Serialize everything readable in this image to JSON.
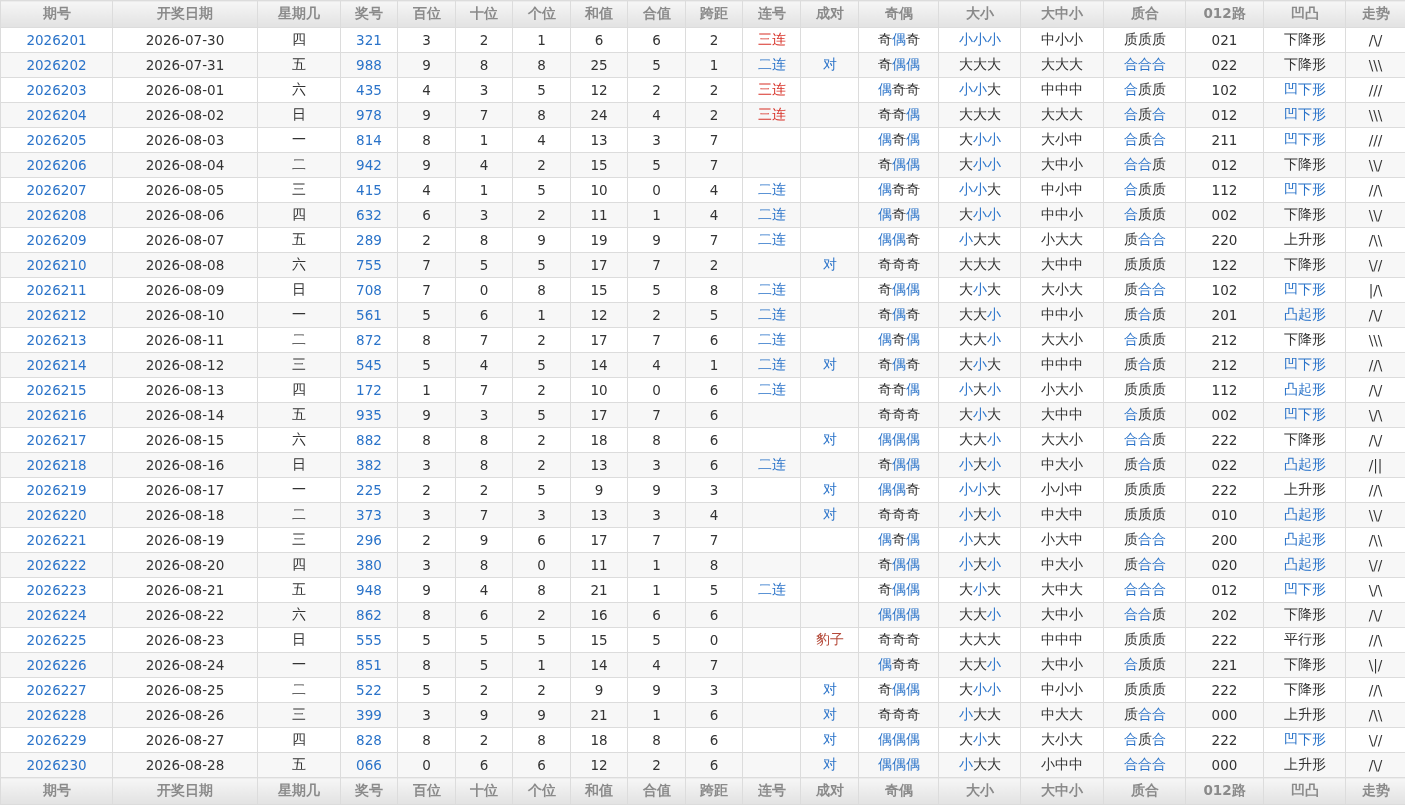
{
  "columns": [
    "期号",
    "开奖日期",
    "星期几",
    "奖号",
    "百位",
    "十位",
    "个位",
    "和值",
    "合值",
    "跨距",
    "连号",
    "成对",
    "奇偶",
    "大小",
    "大中小",
    "质合",
    "012路",
    "凹凸",
    "走势"
  ],
  "rows": [
    {
      "issue": "2026201",
      "date": "2026-07-30",
      "weekday": "四",
      "number": "321",
      "hundreds": "3",
      "tens": "2",
      "units": "1",
      "sum": "6",
      "sum_tail": "6",
      "span": "2",
      "consec": {
        "text": "三连",
        "kind": "triple"
      },
      "odd_even": [
        [
          "奇",
          false
        ],
        [
          "偶",
          true
        ],
        [
          "奇",
          false
        ]
      ],
      "big_small": [
        [
          "小",
          true
        ],
        [
          "小",
          true
        ],
        [
          "小",
          true
        ]
      ],
      "big_mid_small": "中小小",
      "prime_composite": [
        [
          "质",
          false
        ],
        [
          "质",
          false
        ],
        [
          "质",
          false
        ]
      ],
      "route_012": "021",
      "shape": {
        "text": "下降形",
        "highlight": false
      },
      "trend": "/\\/"
    },
    {
      "issue": "2026202",
      "date": "2026-07-31",
      "weekday": "五",
      "number": "988",
      "hundreds": "9",
      "tens": "8",
      "units": "8",
      "sum": "25",
      "sum_tail": "5",
      "span": "1",
      "consec": {
        "text": "二连",
        "kind": "double"
      },
      "pair": {
        "text": "对",
        "kind": "pair"
      },
      "odd_even": [
        [
          "奇",
          false
        ],
        [
          "偶",
          true
        ],
        [
          "偶",
          true
        ]
      ],
      "big_small": [
        [
          "大",
          false
        ],
        [
          "大",
          false
        ],
        [
          "大",
          false
        ]
      ],
      "big_mid_small": "大大大",
      "prime_composite": [
        [
          "合",
          true
        ],
        [
          "合",
          true
        ],
        [
          "合",
          true
        ]
      ],
      "route_012": "022",
      "shape": {
        "text": "下降形",
        "highlight": false
      },
      "trend": "\\\\\\"
    },
    {
      "issue": "2026203",
      "date": "2026-08-01",
      "weekday": "六",
      "number": "435",
      "hundreds": "4",
      "tens": "3",
      "units": "5",
      "sum": "12",
      "sum_tail": "2",
      "span": "2",
      "consec": {
        "text": "三连",
        "kind": "triple"
      },
      "odd_even": [
        [
          "偶",
          true
        ],
        [
          "奇",
          false
        ],
        [
          "奇",
          false
        ]
      ],
      "big_small": [
        [
          "小",
          true
        ],
        [
          "小",
          true
        ],
        [
          "大",
          false
        ]
      ],
      "big_mid_small": "中中中",
      "prime_composite": [
        [
          "合",
          true
        ],
        [
          "质",
          false
        ],
        [
          "质",
          false
        ]
      ],
      "route_012": "102",
      "shape": {
        "text": "凹下形",
        "highlight": true
      },
      "trend": "///"
    },
    {
      "issue": "2026204",
      "date": "2026-08-02",
      "weekday": "日",
      "number": "978",
      "hundreds": "9",
      "tens": "7",
      "units": "8",
      "sum": "24",
      "sum_tail": "4",
      "span": "2",
      "consec": {
        "text": "三连",
        "kind": "triple"
      },
      "odd_even": [
        [
          "奇",
          false
        ],
        [
          "奇",
          false
        ],
        [
          "偶",
          true
        ]
      ],
      "big_small": [
        [
          "大",
          false
        ],
        [
          "大",
          false
        ],
        [
          "大",
          false
        ]
      ],
      "big_mid_small": "大大大",
      "prime_composite": [
        [
          "合",
          true
        ],
        [
          "质",
          false
        ],
        [
          "合",
          true
        ]
      ],
      "route_012": "012",
      "shape": {
        "text": "凹下形",
        "highlight": true
      },
      "trend": "\\\\\\"
    },
    {
      "issue": "2026205",
      "date": "2026-08-03",
      "weekday": "一",
      "number": "814",
      "hundreds": "8",
      "tens": "1",
      "units": "4",
      "sum": "13",
      "sum_tail": "3",
      "span": "7",
      "odd_even": [
        [
          "偶",
          true
        ],
        [
          "奇",
          false
        ],
        [
          "偶",
          true
        ]
      ],
      "big_small": [
        [
          "大",
          false
        ],
        [
          "小",
          true
        ],
        [
          "小",
          true
        ]
      ],
      "big_mid_small": "大小中",
      "prime_composite": [
        [
          "合",
          true
        ],
        [
          "质",
          false
        ],
        [
          "合",
          true
        ]
      ],
      "route_012": "211",
      "shape": {
        "text": "凹下形",
        "highlight": true
      },
      "trend": "///"
    },
    {
      "issue": "2026206",
      "date": "2026-08-04",
      "weekday": "二",
      "number": "942",
      "hundreds": "9",
      "tens": "4",
      "units": "2",
      "sum": "15",
      "sum_tail": "5",
      "span": "7",
      "odd_even": [
        [
          "奇",
          false
        ],
        [
          "偶",
          true
        ],
        [
          "偶",
          true
        ]
      ],
      "big_small": [
        [
          "大",
          false
        ],
        [
          "小",
          true
        ],
        [
          "小",
          true
        ]
      ],
      "big_mid_small": "大中小",
      "prime_composite": [
        [
          "合",
          true
        ],
        [
          "合",
          true
        ],
        [
          "质",
          false
        ]
      ],
      "route_012": "012",
      "shape": {
        "text": "下降形",
        "highlight": false
      },
      "trend": "\\\\/"
    },
    {
      "issue": "2026207",
      "date": "2026-08-05",
      "weekday": "三",
      "number": "415",
      "hundreds": "4",
      "tens": "1",
      "units": "5",
      "sum": "10",
      "sum_tail": "0",
      "span": "4",
      "consec": {
        "text": "二连",
        "kind": "double"
      },
      "odd_even": [
        [
          "偶",
          true
        ],
        [
          "奇",
          false
        ],
        [
          "奇",
          false
        ]
      ],
      "big_small": [
        [
          "小",
          true
        ],
        [
          "小",
          true
        ],
        [
          "大",
          false
        ]
      ],
      "big_mid_small": "中小中",
      "prime_composite": [
        [
          "合",
          true
        ],
        [
          "质",
          false
        ],
        [
          "质",
          false
        ]
      ],
      "route_012": "112",
      "shape": {
        "text": "凹下形",
        "highlight": true
      },
      "trend": "//\\"
    },
    {
      "issue": "2026208",
      "date": "2026-08-06",
      "weekday": "四",
      "number": "632",
      "hundreds": "6",
      "tens": "3",
      "units": "2",
      "sum": "11",
      "sum_tail": "1",
      "span": "4",
      "consec": {
        "text": "二连",
        "kind": "double"
      },
      "odd_even": [
        [
          "偶",
          true
        ],
        [
          "奇",
          false
        ],
        [
          "偶",
          true
        ]
      ],
      "big_small": [
        [
          "大",
          false
        ],
        [
          "小",
          true
        ],
        [
          "小",
          true
        ]
      ],
      "big_mid_small": "中中小",
      "prime_composite": [
        [
          "合",
          true
        ],
        [
          "质",
          false
        ],
        [
          "质",
          false
        ]
      ],
      "route_012": "002",
      "shape": {
        "text": "下降形",
        "highlight": false
      },
      "trend": "\\\\/"
    },
    {
      "issue": "2026209",
      "date": "2026-08-07",
      "weekday": "五",
      "number": "289",
      "hundreds": "2",
      "tens": "8",
      "units": "9",
      "sum": "19",
      "sum_tail": "9",
      "span": "7",
      "consec": {
        "text": "二连",
        "kind": "double"
      },
      "odd_even": [
        [
          "偶",
          true
        ],
        [
          "偶",
          true
        ],
        [
          "奇",
          false
        ]
      ],
      "big_small": [
        [
          "小",
          true
        ],
        [
          "大",
          false
        ],
        [
          "大",
          false
        ]
      ],
      "big_mid_small": "小大大",
      "prime_composite": [
        [
          "质",
          false
        ],
        [
          "合",
          true
        ],
        [
          "合",
          true
        ]
      ],
      "route_012": "220",
      "shape": {
        "text": "上升形",
        "highlight": false
      },
      "trend": "/\\\\"
    },
    {
      "issue": "2026210",
      "date": "2026-08-08",
      "weekday": "六",
      "number": "755",
      "hundreds": "7",
      "tens": "5",
      "units": "5",
      "sum": "17",
      "sum_tail": "7",
      "span": "2",
      "pair": {
        "text": "对",
        "kind": "pair"
      },
      "odd_even": [
        [
          "奇",
          false
        ],
        [
          "奇",
          false
        ],
        [
          "奇",
          false
        ]
      ],
      "big_small": [
        [
          "大",
          false
        ],
        [
          "大",
          false
        ],
        [
          "大",
          false
        ]
      ],
      "big_mid_small": "大中中",
      "prime_composite": [
        [
          "质",
          false
        ],
        [
          "质",
          false
        ],
        [
          "质",
          false
        ]
      ],
      "route_012": "122",
      "shape": {
        "text": "下降形",
        "highlight": false
      },
      "trend": "\\//"
    },
    {
      "issue": "2026211",
      "date": "2026-08-09",
      "weekday": "日",
      "number": "708",
      "hundreds": "7",
      "tens": "0",
      "units": "8",
      "sum": "15",
      "sum_tail": "5",
      "span": "8",
      "consec": {
        "text": "二连",
        "kind": "double"
      },
      "odd_even": [
        [
          "奇",
          false
        ],
        [
          "偶",
          true
        ],
        [
          "偶",
          true
        ]
      ],
      "big_small": [
        [
          "大",
          false
        ],
        [
          "小",
          true
        ],
        [
          "大",
          false
        ]
      ],
      "big_mid_small": "大小大",
      "prime_composite": [
        [
          "质",
          false
        ],
        [
          "合",
          true
        ],
        [
          "合",
          true
        ]
      ],
      "route_012": "102",
      "shape": {
        "text": "凹下形",
        "highlight": true
      },
      "trend": "|/\\"
    },
    {
      "issue": "2026212",
      "date": "2026-08-10",
      "weekday": "一",
      "number": "561",
      "hundreds": "5",
      "tens": "6",
      "units": "1",
      "sum": "12",
      "sum_tail": "2",
      "span": "5",
      "consec": {
        "text": "二连",
        "kind": "double"
      },
      "odd_even": [
        [
          "奇",
          false
        ],
        [
          "偶",
          true
        ],
        [
          "奇",
          false
        ]
      ],
      "big_small": [
        [
          "大",
          false
        ],
        [
          "大",
          false
        ],
        [
          "小",
          true
        ]
      ],
      "big_mid_small": "中中小",
      "prime_composite": [
        [
          "质",
          false
        ],
        [
          "合",
          true
        ],
        [
          "质",
          false
        ]
      ],
      "route_012": "201",
      "shape": {
        "text": "凸起形",
        "highlight": true
      },
      "trend": "/\\/"
    },
    {
      "issue": "2026213",
      "date": "2026-08-11",
      "weekday": "二",
      "number": "872",
      "hundreds": "8",
      "tens": "7",
      "units": "2",
      "sum": "17",
      "sum_tail": "7",
      "span": "6",
      "consec": {
        "text": "二连",
        "kind": "double"
      },
      "odd_even": [
        [
          "偶",
          true
        ],
        [
          "奇",
          false
        ],
        [
          "偶",
          true
        ]
      ],
      "big_small": [
        [
          "大",
          false
        ],
        [
          "大",
          false
        ],
        [
          "小",
          true
        ]
      ],
      "big_mid_small": "大大小",
      "prime_composite": [
        [
          "合",
          true
        ],
        [
          "质",
          false
        ],
        [
          "质",
          false
        ]
      ],
      "route_012": "212",
      "shape": {
        "text": "下降形",
        "highlight": false
      },
      "trend": "\\\\\\"
    },
    {
      "issue": "2026214",
      "date": "2026-08-12",
      "weekday": "三",
      "number": "545",
      "hundreds": "5",
      "tens": "4",
      "units": "5",
      "sum": "14",
      "sum_tail": "4",
      "span": "1",
      "consec": {
        "text": "二连",
        "kind": "double"
      },
      "pair": {
        "text": "对",
        "kind": "pair"
      },
      "odd_even": [
        [
          "奇",
          false
        ],
        [
          "偶",
          true
        ],
        [
          "奇",
          false
        ]
      ],
      "big_small": [
        [
          "大",
          false
        ],
        [
          "小",
          true
        ],
        [
          "大",
          false
        ]
      ],
      "big_mid_small": "中中中",
      "prime_composite": [
        [
          "质",
          false
        ],
        [
          "合",
          true
        ],
        [
          "质",
          false
        ]
      ],
      "route_012": "212",
      "shape": {
        "text": "凹下形",
        "highlight": true
      },
      "trend": "//\\"
    },
    {
      "issue": "2026215",
      "date": "2026-08-13",
      "weekday": "四",
      "number": "172",
      "hundreds": "1",
      "tens": "7",
      "units": "2",
      "sum": "10",
      "sum_tail": "0",
      "span": "6",
      "consec": {
        "text": "二连",
        "kind": "double"
      },
      "odd_even": [
        [
          "奇",
          false
        ],
        [
          "奇",
          false
        ],
        [
          "偶",
          true
        ]
      ],
      "big_small": [
        [
          "小",
          true
        ],
        [
          "大",
          false
        ],
        [
          "小",
          true
        ]
      ],
      "big_mid_small": "小大小",
      "prime_composite": [
        [
          "质",
          false
        ],
        [
          "质",
          false
        ],
        [
          "质",
          false
        ]
      ],
      "route_012": "112",
      "shape": {
        "text": "凸起形",
        "highlight": true
      },
      "trend": "/\\/"
    },
    {
      "issue": "2026216",
      "date": "2026-08-14",
      "weekday": "五",
      "number": "935",
      "hundreds": "9",
      "tens": "3",
      "units": "5",
      "sum": "17",
      "sum_tail": "7",
      "span": "6",
      "odd_even": [
        [
          "奇",
          false
        ],
        [
          "奇",
          false
        ],
        [
          "奇",
          false
        ]
      ],
      "big_small": [
        [
          "大",
          false
        ],
        [
          "小",
          true
        ],
        [
          "大",
          false
        ]
      ],
      "big_mid_small": "大中中",
      "prime_composite": [
        [
          "合",
          true
        ],
        [
          "质",
          false
        ],
        [
          "质",
          false
        ]
      ],
      "route_012": "002",
      "shape": {
        "text": "凹下形",
        "highlight": true
      },
      "trend": "\\/\\"
    },
    {
      "issue": "2026217",
      "date": "2026-08-15",
      "weekday": "六",
      "number": "882",
      "hundreds": "8",
      "tens": "8",
      "units": "2",
      "sum": "18",
      "sum_tail": "8",
      "span": "6",
      "pair": {
        "text": "对",
        "kind": "pair"
      },
      "odd_even": [
        [
          "偶",
          true
        ],
        [
          "偶",
          true
        ],
        [
          "偶",
          true
        ]
      ],
      "big_small": [
        [
          "大",
          false
        ],
        [
          "大",
          false
        ],
        [
          "小",
          true
        ]
      ],
      "big_mid_small": "大大小",
      "prime_composite": [
        [
          "合",
          true
        ],
        [
          "合",
          true
        ],
        [
          "质",
          false
        ]
      ],
      "route_012": "222",
      "shape": {
        "text": "下降形",
        "highlight": false
      },
      "trend": "/\\/"
    },
    {
      "issue": "2026218",
      "date": "2026-08-16",
      "weekday": "日",
      "number": "382",
      "hundreds": "3",
      "tens": "8",
      "units": "2",
      "sum": "13",
      "sum_tail": "3",
      "span": "6",
      "consec": {
        "text": "二连",
        "kind": "double"
      },
      "odd_even": [
        [
          "奇",
          false
        ],
        [
          "偶",
          true
        ],
        [
          "偶",
          true
        ]
      ],
      "big_small": [
        [
          "小",
          true
        ],
        [
          "大",
          false
        ],
        [
          "小",
          true
        ]
      ],
      "big_mid_small": "中大小",
      "prime_composite": [
        [
          "质",
          false
        ],
        [
          "合",
          true
        ],
        [
          "质",
          false
        ]
      ],
      "route_012": "022",
      "shape": {
        "text": "凸起形",
        "highlight": true
      },
      "trend": "/||"
    },
    {
      "issue": "2026219",
      "date": "2026-08-17",
      "weekday": "一",
      "number": "225",
      "hundreds": "2",
      "tens": "2",
      "units": "5",
      "sum": "9",
      "sum_tail": "9",
      "span": "3",
      "pair": {
        "text": "对",
        "kind": "pair"
      },
      "odd_even": [
        [
          "偶",
          true
        ],
        [
          "偶",
          true
        ],
        [
          "奇",
          false
        ]
      ],
      "big_small": [
        [
          "小",
          true
        ],
        [
          "小",
          true
        ],
        [
          "大",
          false
        ]
      ],
      "big_mid_small": "小小中",
      "prime_composite": [
        [
          "质",
          false
        ],
        [
          "质",
          false
        ],
        [
          "质",
          false
        ]
      ],
      "route_012": "222",
      "shape": {
        "text": "上升形",
        "highlight": false
      },
      "trend": "//\\"
    },
    {
      "issue": "2026220",
      "date": "2026-08-18",
      "weekday": "二",
      "number": "373",
      "hundreds": "3",
      "tens": "7",
      "units": "3",
      "sum": "13",
      "sum_tail": "3",
      "span": "4",
      "pair": {
        "text": "对",
        "kind": "pair"
      },
      "odd_even": [
        [
          "奇",
          false
        ],
        [
          "奇",
          false
        ],
        [
          "奇",
          false
        ]
      ],
      "big_small": [
        [
          "小",
          true
        ],
        [
          "大",
          false
        ],
        [
          "小",
          true
        ]
      ],
      "big_mid_small": "中大中",
      "prime_composite": [
        [
          "质",
          false
        ],
        [
          "质",
          false
        ],
        [
          "质",
          false
        ]
      ],
      "route_012": "010",
      "shape": {
        "text": "凸起形",
        "highlight": true
      },
      "trend": "\\\\/"
    },
    {
      "issue": "2026221",
      "date": "2026-08-19",
      "weekday": "三",
      "number": "296",
      "hundreds": "2",
      "tens": "9",
      "units": "6",
      "sum": "17",
      "sum_tail": "7",
      "span": "7",
      "odd_even": [
        [
          "偶",
          true
        ],
        [
          "奇",
          false
        ],
        [
          "偶",
          true
        ]
      ],
      "big_small": [
        [
          "小",
          true
        ],
        [
          "大",
          false
        ],
        [
          "大",
          false
        ]
      ],
      "big_mid_small": "小大中",
      "prime_composite": [
        [
          "质",
          false
        ],
        [
          "合",
          true
        ],
        [
          "合",
          true
        ]
      ],
      "route_012": "200",
      "shape": {
        "text": "凸起形",
        "highlight": true
      },
      "trend": "/\\\\"
    },
    {
      "issue": "2026222",
      "date": "2026-08-20",
      "weekday": "四",
      "number": "380",
      "hundreds": "3",
      "tens": "8",
      "units": "0",
      "sum": "11",
      "sum_tail": "1",
      "span": "8",
      "odd_even": [
        [
          "奇",
          false
        ],
        [
          "偶",
          true
        ],
        [
          "偶",
          true
        ]
      ],
      "big_small": [
        [
          "小",
          true
        ],
        [
          "大",
          false
        ],
        [
          "小",
          true
        ]
      ],
      "big_mid_small": "中大小",
      "prime_composite": [
        [
          "质",
          false
        ],
        [
          "合",
          true
        ],
        [
          "合",
          true
        ]
      ],
      "route_012": "020",
      "shape": {
        "text": "凸起形",
        "highlight": true
      },
      "trend": "\\//"
    },
    {
      "issue": "2026223",
      "date": "2026-08-21",
      "weekday": "五",
      "number": "948",
      "hundreds": "9",
      "tens": "4",
      "units": "8",
      "sum": "21",
      "sum_tail": "1",
      "span": "5",
      "consec": {
        "text": "二连",
        "kind": "double"
      },
      "odd_even": [
        [
          "奇",
          false
        ],
        [
          "偶",
          true
        ],
        [
          "偶",
          true
        ]
      ],
      "big_small": [
        [
          "大",
          false
        ],
        [
          "小",
          true
        ],
        [
          "大",
          false
        ]
      ],
      "big_mid_small": "大中大",
      "prime_composite": [
        [
          "合",
          true
        ],
        [
          "合",
          true
        ],
        [
          "合",
          true
        ]
      ],
      "route_012": "012",
      "shape": {
        "text": "凹下形",
        "highlight": true
      },
      "trend": "\\/\\"
    },
    {
      "issue": "2026224",
      "date": "2026-08-22",
      "weekday": "六",
      "number": "862",
      "hundreds": "8",
      "tens": "6",
      "units": "2",
      "sum": "16",
      "sum_tail": "6",
      "span": "6",
      "odd_even": [
        [
          "偶",
          true
        ],
        [
          "偶",
          true
        ],
        [
          "偶",
          true
        ]
      ],
      "big_small": [
        [
          "大",
          false
        ],
        [
          "大",
          false
        ],
        [
          "小",
          true
        ]
      ],
      "big_mid_small": "大中小",
      "prime_composite": [
        [
          "合",
          true
        ],
        [
          "合",
          true
        ],
        [
          "质",
          false
        ]
      ],
      "route_012": "202",
      "shape": {
        "text": "下降形",
        "highlight": false
      },
      "trend": "/\\/"
    },
    {
      "issue": "2026225",
      "date": "2026-08-23",
      "weekday": "日",
      "number": "555",
      "hundreds": "5",
      "tens": "5",
      "units": "5",
      "sum": "15",
      "sum_tail": "5",
      "span": "0",
      "pair": {
        "text": "豹子",
        "kind": "leopard"
      },
      "odd_even": [
        [
          "奇",
          false
        ],
        [
          "奇",
          false
        ],
        [
          "奇",
          false
        ]
      ],
      "big_small": [
        [
          "大",
          false
        ],
        [
          "大",
          false
        ],
        [
          "大",
          false
        ]
      ],
      "big_mid_small": "中中中",
      "prime_composite": [
        [
          "质",
          false
        ],
        [
          "质",
          false
        ],
        [
          "质",
          false
        ]
      ],
      "route_012": "222",
      "shape": {
        "text": "平行形",
        "highlight": false
      },
      "trend": "//\\"
    },
    {
      "issue": "2026226",
      "date": "2026-08-24",
      "weekday": "一",
      "number": "851",
      "hundreds": "8",
      "tens": "5",
      "units": "1",
      "sum": "14",
      "sum_tail": "4",
      "span": "7",
      "odd_even": [
        [
          "偶",
          true
        ],
        [
          "奇",
          false
        ],
        [
          "奇",
          false
        ]
      ],
      "big_small": [
        [
          "大",
          false
        ],
        [
          "大",
          false
        ],
        [
          "小",
          true
        ]
      ],
      "big_mid_small": "大中小",
      "prime_composite": [
        [
          "合",
          true
        ],
        [
          "质",
          false
        ],
        [
          "质",
          false
        ]
      ],
      "route_012": "221",
      "shape": {
        "text": "下降形",
        "highlight": false
      },
      "trend": "\\|/"
    },
    {
      "issue": "2026227",
      "date": "2026-08-25",
      "weekday": "二",
      "number": "522",
      "hundreds": "5",
      "tens": "2",
      "units": "2",
      "sum": "9",
      "sum_tail": "9",
      "span": "3",
      "pair": {
        "text": "对",
        "kind": "pair"
      },
      "odd_even": [
        [
          "奇",
          false
        ],
        [
          "偶",
          true
        ],
        [
          "偶",
          true
        ]
      ],
      "big_small": [
        [
          "大",
          false
        ],
        [
          "小",
          true
        ],
        [
          "小",
          true
        ]
      ],
      "big_mid_small": "中小小",
      "prime_composite": [
        [
          "质",
          false
        ],
        [
          "质",
          false
        ],
        [
          "质",
          false
        ]
      ],
      "route_012": "222",
      "shape": {
        "text": "下降形",
        "highlight": false
      },
      "trend": "//\\"
    },
    {
      "issue": "2026228",
      "date": "2026-08-26",
      "weekday": "三",
      "number": "399",
      "hundreds": "3",
      "tens": "9",
      "units": "9",
      "sum": "21",
      "sum_tail": "1",
      "span": "6",
      "pair": {
        "text": "对",
        "kind": "pair"
      },
      "odd_even": [
        [
          "奇",
          false
        ],
        [
          "奇",
          false
        ],
        [
          "奇",
          false
        ]
      ],
      "big_small": [
        [
          "小",
          true
        ],
        [
          "大",
          false
        ],
        [
          "大",
          false
        ]
      ],
      "big_mid_small": "中大大",
      "prime_composite": [
        [
          "质",
          false
        ],
        [
          "合",
          true
        ],
        [
          "合",
          true
        ]
      ],
      "route_012": "000",
      "shape": {
        "text": "上升形",
        "highlight": false
      },
      "trend": "/\\\\"
    },
    {
      "issue": "2026229",
      "date": "2026-08-27",
      "weekday": "四",
      "number": "828",
      "hundreds": "8",
      "tens": "2",
      "units": "8",
      "sum": "18",
      "sum_tail": "8",
      "span": "6",
      "pair": {
        "text": "对",
        "kind": "pair"
      },
      "odd_even": [
        [
          "偶",
          true
        ],
        [
          "偶",
          true
        ],
        [
          "偶",
          true
        ]
      ],
      "big_small": [
        [
          "大",
          false
        ],
        [
          "小",
          true
        ],
        [
          "大",
          false
        ]
      ],
      "big_mid_small": "大小大",
      "prime_composite": [
        [
          "合",
          true
        ],
        [
          "质",
          false
        ],
        [
          "合",
          true
        ]
      ],
      "route_012": "222",
      "shape": {
        "text": "凹下形",
        "highlight": true
      },
      "trend": "\\//"
    },
    {
      "issue": "2026230",
      "date": "2026-08-28",
      "weekday": "五",
      "number": "066",
      "hundreds": "0",
      "tens": "6",
      "units": "6",
      "sum": "12",
      "sum_tail": "2",
      "span": "6",
      "pair": {
        "text": "对",
        "kind": "pair"
      },
      "odd_even": [
        [
          "偶",
          true
        ],
        [
          "偶",
          true
        ],
        [
          "偶",
          true
        ]
      ],
      "big_small": [
        [
          "小",
          true
        ],
        [
          "大",
          false
        ],
        [
          "大",
          false
        ]
      ],
      "big_mid_small": "小中中",
      "prime_composite": [
        [
          "合",
          true
        ],
        [
          "合",
          true
        ],
        [
          "合",
          true
        ]
      ],
      "route_012": "000",
      "shape": {
        "text": "上升形",
        "highlight": false
      },
      "trend": "/\\/"
    }
  ],
  "footer_columns": [
    "期号",
    "开奖日期",
    "星期几",
    "奖号",
    "百位",
    "十位",
    "个位",
    "和值",
    "合值",
    "跨距",
    "连号",
    "成对",
    "奇偶",
    "大小",
    "大中小",
    "质合",
    "012路",
    "凹凸",
    "走势"
  ]
}
